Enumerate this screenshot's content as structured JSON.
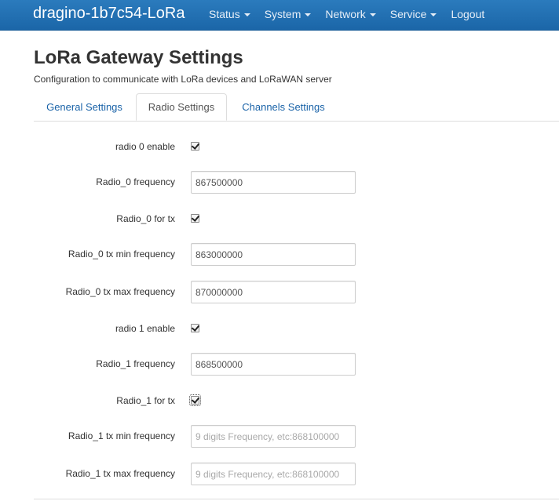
{
  "navbar": {
    "brand": "dragino-1b7c54-LoRa",
    "items": [
      {
        "label": "Status",
        "has_caret": true
      },
      {
        "label": "System",
        "has_caret": true
      },
      {
        "label": "Network",
        "has_caret": true
      },
      {
        "label": "Service",
        "has_caret": true
      },
      {
        "label": "Logout",
        "has_caret": false
      }
    ]
  },
  "header": {
    "title": "LoRa Gateway Settings",
    "description": "Configuration to communicate with LoRa devices and LoRaWAN server"
  },
  "tabs": [
    {
      "label": "General Settings",
      "active": false
    },
    {
      "label": "Radio Settings",
      "active": true
    },
    {
      "label": "Channels Settings",
      "active": false
    }
  ],
  "form": {
    "radio0_enable": {
      "label": "radio 0 enable",
      "checked": true
    },
    "radio0_frequency": {
      "label": "Radio_0 frequency",
      "value": "867500000",
      "placeholder": ""
    },
    "radio0_tx": {
      "label": "Radio_0 for tx",
      "checked": true
    },
    "radio0_tx_min": {
      "label": "Radio_0 tx min frequency",
      "value": "863000000",
      "placeholder": ""
    },
    "radio0_tx_max": {
      "label": "Radio_0 tx max frequency",
      "value": "870000000",
      "placeholder": ""
    },
    "radio1_enable": {
      "label": "radio 1 enable",
      "checked": true
    },
    "radio1_frequency": {
      "label": "Radio_1 frequency",
      "value": "868500000",
      "placeholder": ""
    },
    "radio1_tx": {
      "label": "Radio_1 for tx",
      "checked": true
    },
    "radio1_tx_min": {
      "label": "Radio_1 tx min frequency",
      "value": "",
      "placeholder": "9 digits Frequency, etc:868100000"
    },
    "radio1_tx_max": {
      "label": "Radio_1 tx max frequency",
      "value": "",
      "placeholder": "9 digits Frequency, etc:868100000"
    }
  },
  "colors": {
    "navbar": "#1f6fb2",
    "link": "#1a63a8"
  }
}
